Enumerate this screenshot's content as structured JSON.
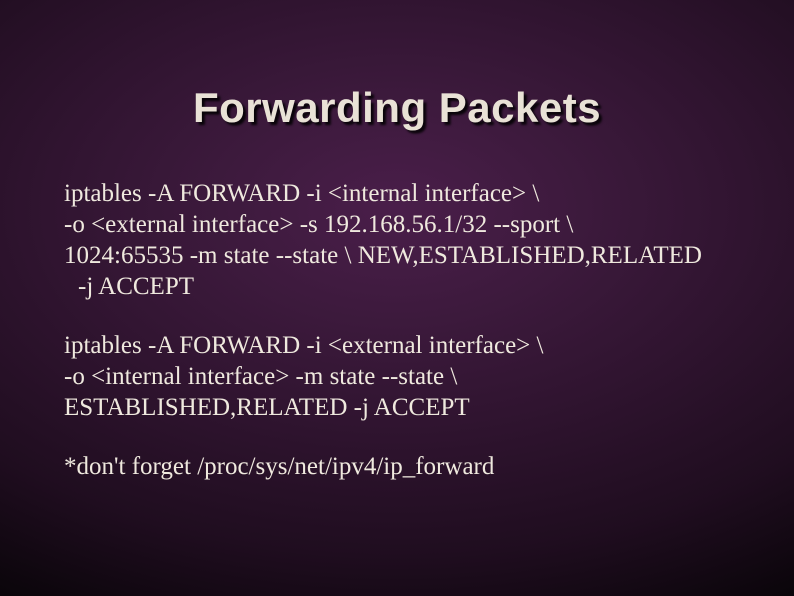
{
  "slide": {
    "title": "Forwarding Packets",
    "para1": {
      "l1": "iptables -A FORWARD -i <internal interface> \\",
      "l2": "-o <external interface> -s 192.168.56.1/32 --sport \\",
      "l3": "1024:65535 -m state --state \\ NEW,ESTABLISHED,RELATED",
      "l4": "-j ACCEPT"
    },
    "para2": {
      "l1": "iptables -A FORWARD -i <external interface> \\",
      "l2": "-o <internal interface> -m state --state \\",
      "l3": "ESTABLISHED,RELATED -j ACCEPT"
    },
    "para3": {
      "l1": "*don't forget /proc/sys/net/ipv4/ip_forward"
    }
  }
}
